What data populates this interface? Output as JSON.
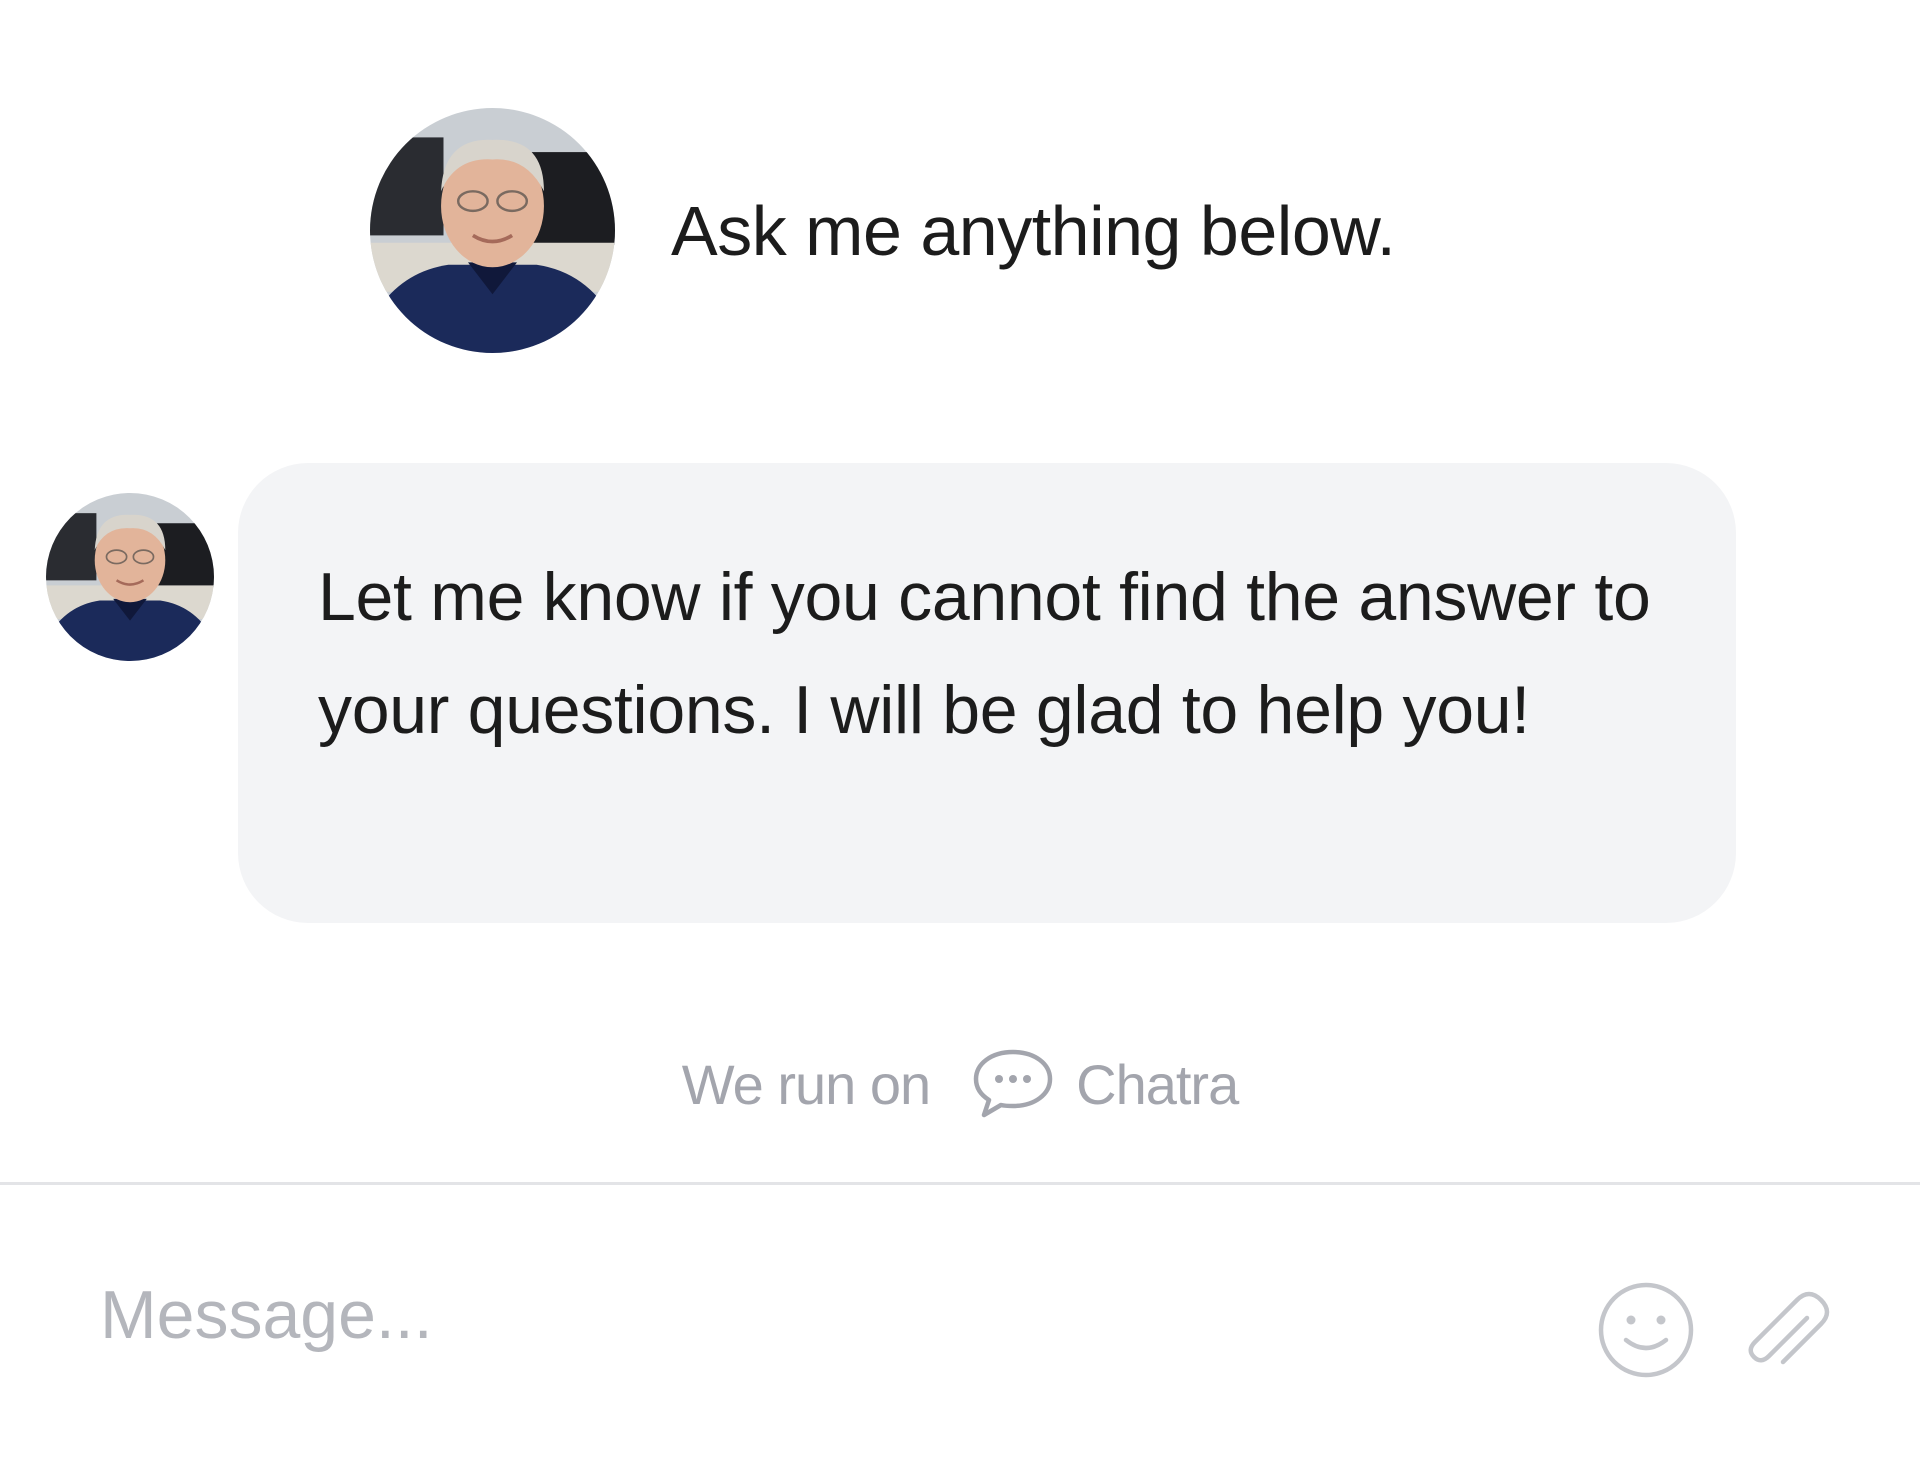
{
  "header": {
    "greeting": "Ask me anything below."
  },
  "conversation": {
    "messages": [
      {
        "text": "Let me know if you cannot find the answer to your questions. I will be glad to help you!"
      }
    ]
  },
  "footer": {
    "powered_prefix": "We run on",
    "brand": "Chatra",
    "icon": "chat-bubble-icon"
  },
  "composer": {
    "placeholder": "Message...",
    "value": "",
    "emoji_icon": "smiley-icon",
    "attach_icon": "paperclip-icon"
  },
  "colors": {
    "bubble_background": "#f3f4f6",
    "muted_text": "#a3a5ad",
    "placeholder_text": "#b4b6bc",
    "text": "#1c1c1c",
    "divider": "#e3e4e7"
  }
}
